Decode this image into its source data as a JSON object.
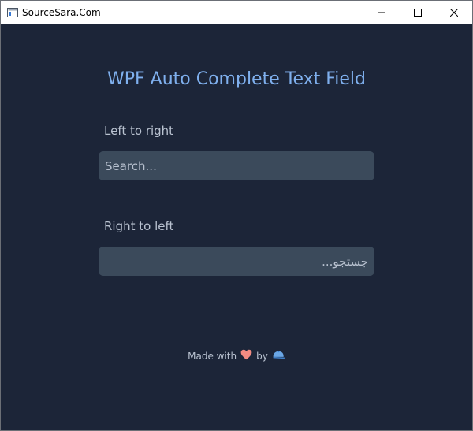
{
  "window": {
    "title": "SourceSara.Com",
    "icon": "window-app-icon",
    "buttons": [
      "minimize-icon",
      "maximize-icon",
      "close-icon"
    ]
  },
  "main": {
    "heading": "WPF Auto Complete Text Field",
    "ltr": {
      "label": "Left to right",
      "placeholder": "Search...",
      "value": ""
    },
    "rtl": {
      "label": "Right to left",
      "placeholder": "جستجو...",
      "value": ""
    }
  },
  "footer": {
    "made_with": "Made with",
    "by": "by",
    "heart_icon": "heart-icon",
    "cap_icon": "cap-icon"
  },
  "colors": {
    "background": "#1c2538",
    "heading": "#7fb0ee",
    "field": "#3b4a5b",
    "label": "#b9c2d0",
    "heart": "#f28b82",
    "cap": "#6aa7e6"
  }
}
